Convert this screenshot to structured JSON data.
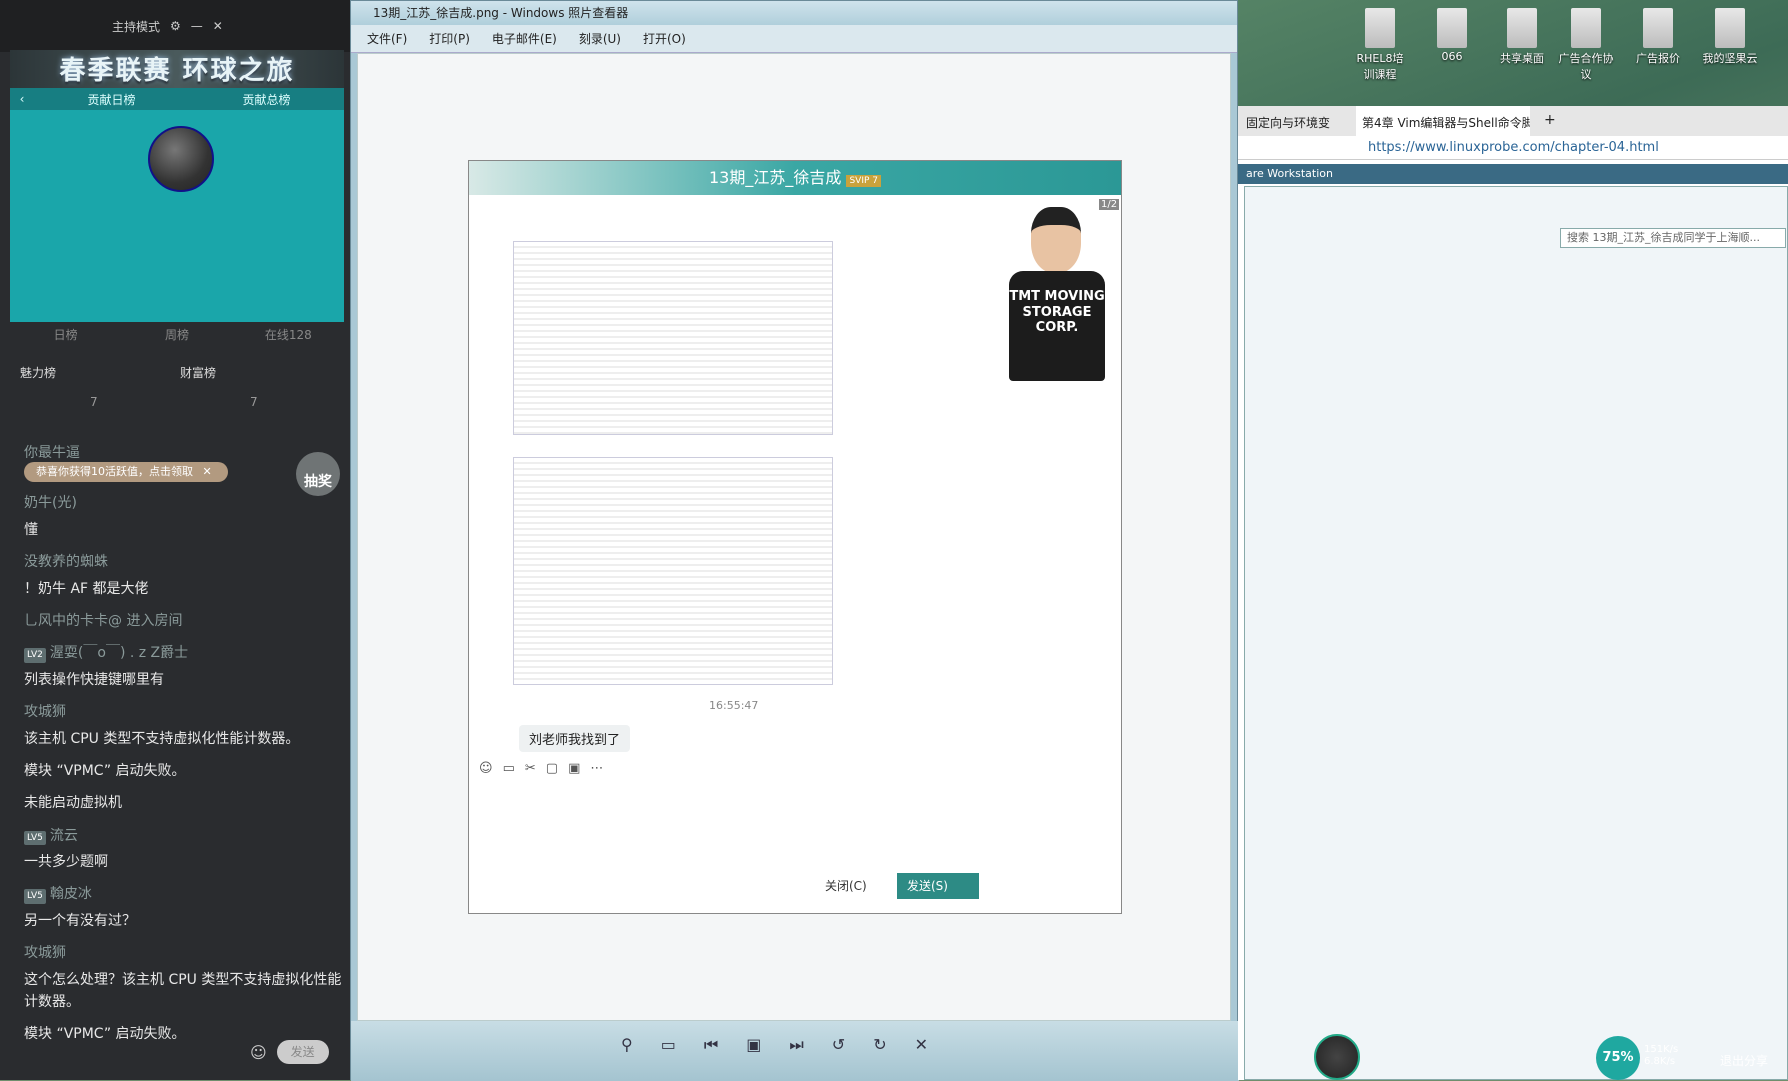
{
  "left_panel": {
    "mode_label": "主持模式",
    "banner": "春季联赛 环球之旅",
    "tabs_top": [
      "贡献日榜",
      "贡献总榜"
    ],
    "tabs_mid": [
      "日榜",
      "周榜",
      "在线128"
    ],
    "rank_labels": [
      "魅力榜",
      "财富榜"
    ],
    "rank_counts": [
      "7",
      "7"
    ],
    "toast": "恭喜你获得10活跃值，点击领取",
    "lottery": "抽奖",
    "chat": [
      {
        "user": "你最牛逼",
        "text": ""
      },
      {
        "user": "奶牛(光)",
        "text": "懂"
      },
      {
        "user": "没教养的蜘蛛",
        "text": "！奶牛 AF 都是大佬"
      },
      {
        "user": "",
        "text": "乚风中的卡卡@ 进入房间"
      },
      {
        "user": "渥耍(￣o￣) . z Z爵士",
        "level": "LV2",
        "text": "列表操作快捷键哪里有"
      },
      {
        "user": "攻城狮",
        "text": "该主机 CPU 类型不支持虚拟化性能计数器。"
      },
      {
        "user": "",
        "text": "模块 “VPMC” 启动失败。"
      },
      {
        "user": "",
        "text": "未能启动虚拟机"
      },
      {
        "user": "流云",
        "level": "LV5",
        "text": "一共多少题啊"
      },
      {
        "user": "翰皮冰",
        "level": "LV5",
        "text": "另一个有没有过？"
      },
      {
        "user": "攻城狮",
        "text": "这个怎么处理？该主机 CPU 类型不支持虚拟化性能计数器。"
      },
      {
        "user": "",
        "text": "模块 “VPMC” 启动失败。"
      }
    ],
    "send_label": "发送"
  },
  "viewer": {
    "title": "13期_江苏_徐吉成.png - Windows 照片查看器",
    "menu": [
      "文件(F)",
      "打印(P)",
      "电子邮件(E)",
      "刻录(U)",
      "打开(O)"
    ]
  },
  "qq": {
    "title": "13期_江苏_徐吉成",
    "badge": "SVIP 7",
    "time": "16:55:47",
    "message": "刘老师我找到了",
    "close_label": "关闭(C)",
    "send_label": "发送(S)",
    "page_counter": "1/2",
    "shirt_text": "TMT MOVING STORAGE CORP."
  },
  "browser": {
    "tab_prev": "固定向与环境变",
    "tab_active": "第4章 Vim编辑器与Shell命令脚",
    "url": "https://www.linuxprobe.com/chapter-04.html",
    "vmware": "are Workstation",
    "search_placeholder": "搜索 13期_江苏_徐吉成同学于上海顺..."
  },
  "desktop_icons": [
    "RHEL8培训课程",
    "066",
    "共享桌面",
    "广告合作协议",
    "广告报价",
    "我的坚果云"
  ],
  "tray": {
    "gauge": "75%",
    "up": "151K/s",
    "down": "6.8K/s",
    "share": "退出分享"
  }
}
